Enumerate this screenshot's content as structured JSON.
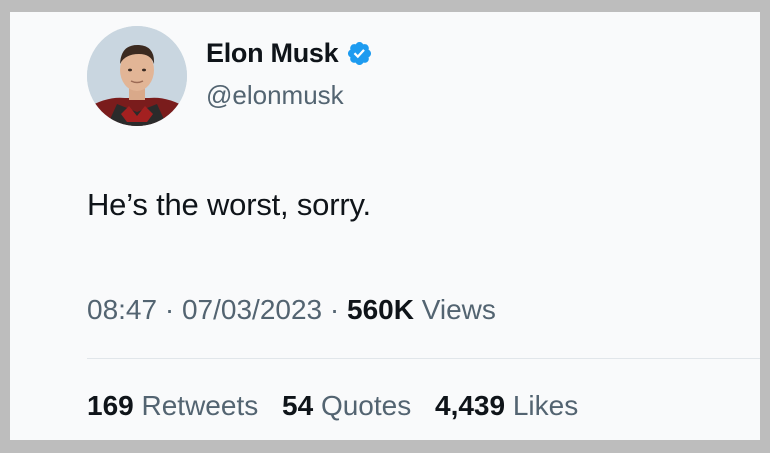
{
  "user": {
    "name": "Elon Musk",
    "handle": "@elonmusk"
  },
  "tweet": {
    "text": "He’s the worst, sorry."
  },
  "meta": {
    "time": "08:47",
    "separator": "·",
    "date": "07/03/2023",
    "views_count": "560K",
    "views_label": "Views"
  },
  "stats": {
    "retweets_count": "169",
    "retweets_label": "Retweets",
    "quotes_count": "54",
    "quotes_label": "Quotes",
    "likes_count": "4,439",
    "likes_label": "Likes"
  },
  "colors": {
    "verified": "#1d9bf0",
    "text_primary": "#0f1419",
    "text_secondary": "#536471"
  },
  "icons": {
    "verified": "verified-badge-icon"
  }
}
